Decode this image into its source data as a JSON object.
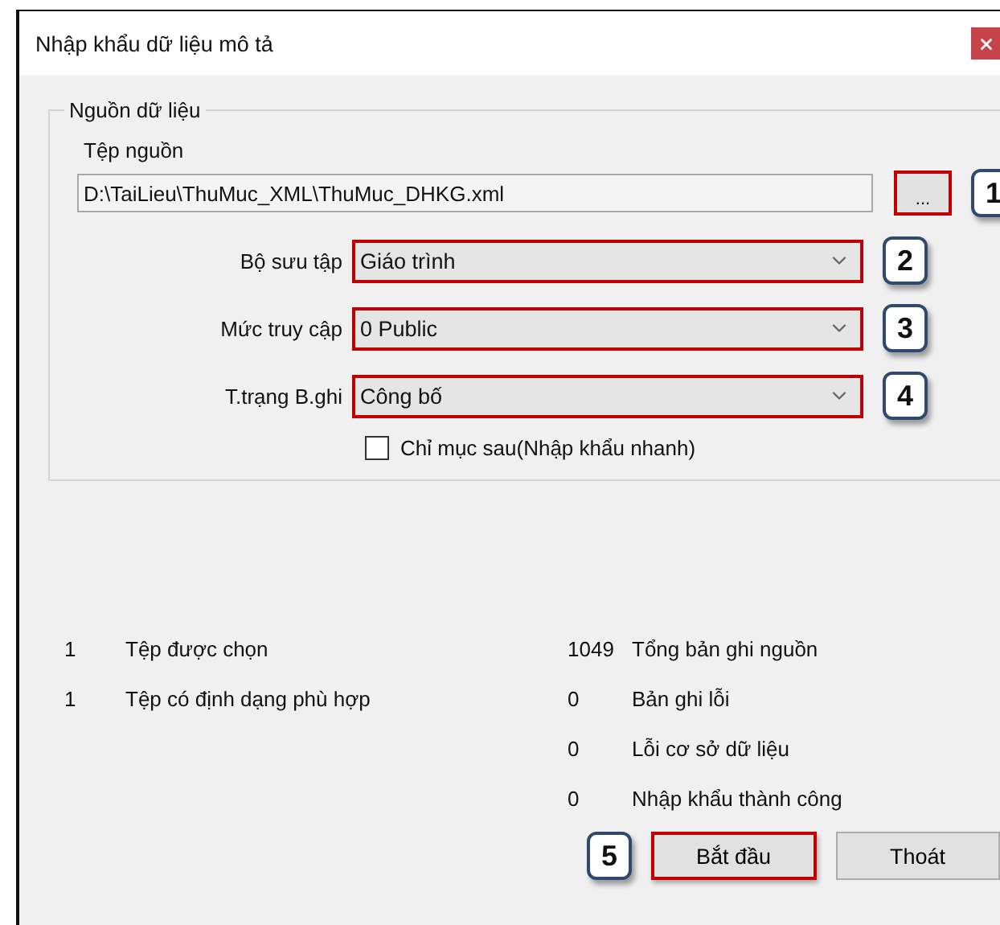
{
  "window": {
    "title": "Nhập khẩu dữ liệu mô tả"
  },
  "group": {
    "title": "Nguồn dữ liệu",
    "source_file": {
      "label": "Tệp nguồn",
      "value": "D:\\TaiLieu\\ThuMuc_XML\\ThuMuc_DHKG.xml",
      "browse": "...",
      "callout": "1"
    },
    "fields": [
      {
        "label": "Bộ sưu tập",
        "value": "Giáo trình",
        "callout": "2"
      },
      {
        "label": "Mức truy cập",
        "value": "0 Public",
        "callout": "3"
      },
      {
        "label": "T.trạng B.ghi",
        "value": "Công bố",
        "callout": "4"
      }
    ],
    "checkbox": {
      "label": "Chỉ mục sau(Nhập khẩu nhanh)",
      "checked": false
    }
  },
  "stats": [
    {
      "left_count": "1",
      "left_label": "Tệp được chọn",
      "right_count": "1049",
      "right_label": "Tổng bản ghi nguồn"
    },
    {
      "left_count": "1",
      "left_label": "Tệp có định dạng phù hợp",
      "right_count": "0",
      "right_label": "Bản ghi lỗi"
    },
    {
      "right_count": "0",
      "right_label": "Lỗi cơ sở dữ liệu"
    },
    {
      "right_count": "0",
      "right_label": "Nhập khẩu thành công"
    }
  ],
  "buttons": [
    {
      "label": "Bắt đầu",
      "callout": "5",
      "highlighted": true
    },
    {
      "label": "Thoát",
      "highlighted": false
    }
  ]
}
